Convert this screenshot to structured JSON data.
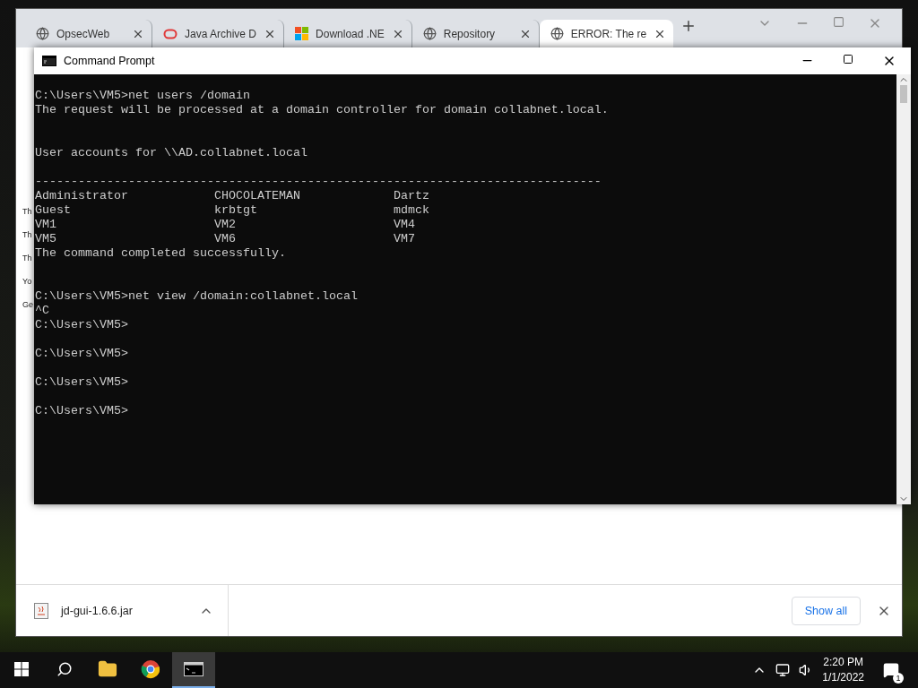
{
  "browser": {
    "tabs": [
      {
        "label": "OpsecWeb",
        "kind": "globe",
        "selected": false
      },
      {
        "label": "Java Archive D",
        "kind": "ring",
        "selected": false
      },
      {
        "label": "Download .NE",
        "kind": "tiles",
        "selected": false
      },
      {
        "label": "Repository",
        "kind": "globe",
        "selected": false
      },
      {
        "label": "ERROR: The re",
        "kind": "globe",
        "selected": true
      }
    ],
    "page_fragments": [
      {
        "text": "Th"
      },
      {
        "text": "Th"
      },
      {
        "text": "Th"
      },
      {
        "text": "Yo"
      },
      {
        "text": "Ge"
      }
    ],
    "downloads": {
      "file": "jd-gui-1.6.6.jar",
      "button": "Show all"
    }
  },
  "console": {
    "title": "Command Prompt",
    "lines": [
      {
        "kind": "text",
        "text": "C:\\Users\\VM5>net users /domain"
      },
      {
        "kind": "text",
        "text": "The request will be processed at a domain controller for domain collabnet.local."
      },
      {
        "kind": "blank"
      },
      {
        "kind": "blank"
      },
      {
        "kind": "text",
        "text": "User accounts for \\\\AD.collabnet.local"
      },
      {
        "kind": "blank"
      },
      {
        "kind": "text",
        "text": "-------------------------------------------------------------------------------"
      },
      {
        "kind": "text",
        "text": "Administrator            CHOCOLATEMAN             Dartz"
      },
      {
        "kind": "text",
        "text": "Guest                    krbtgt                   mdmck"
      },
      {
        "kind": "text",
        "text": "VM1                      VM2                      VM4"
      },
      {
        "kind": "text",
        "text": "VM5                      VM6                      VM7"
      },
      {
        "kind": "text",
        "text": "The command completed successfully."
      },
      {
        "kind": "blank"
      },
      {
        "kind": "blank"
      },
      {
        "kind": "text",
        "text": "C:\\Users\\VM5>net view /domain:collabnet.local"
      },
      {
        "kind": "text",
        "text": "^C"
      },
      {
        "kind": "text",
        "text": "C:\\Users\\VM5>"
      },
      {
        "kind": "blank"
      },
      {
        "kind": "text",
        "text": "C:\\Users\\VM5>"
      },
      {
        "kind": "blank"
      },
      {
        "kind": "text",
        "text": "C:\\Users\\VM5>"
      },
      {
        "kind": "blank"
      },
      {
        "kind": "text",
        "text": "C:\\Users\\VM5>"
      }
    ]
  },
  "taskbar": {
    "apps": [
      {
        "kind": "folder",
        "selected": false
      },
      {
        "kind": "chrome",
        "selected": false
      },
      {
        "kind": "console",
        "selected": true
      }
    ],
    "time": "2:20 PM",
    "date": "1/1/2022",
    "notifications": "1"
  }
}
